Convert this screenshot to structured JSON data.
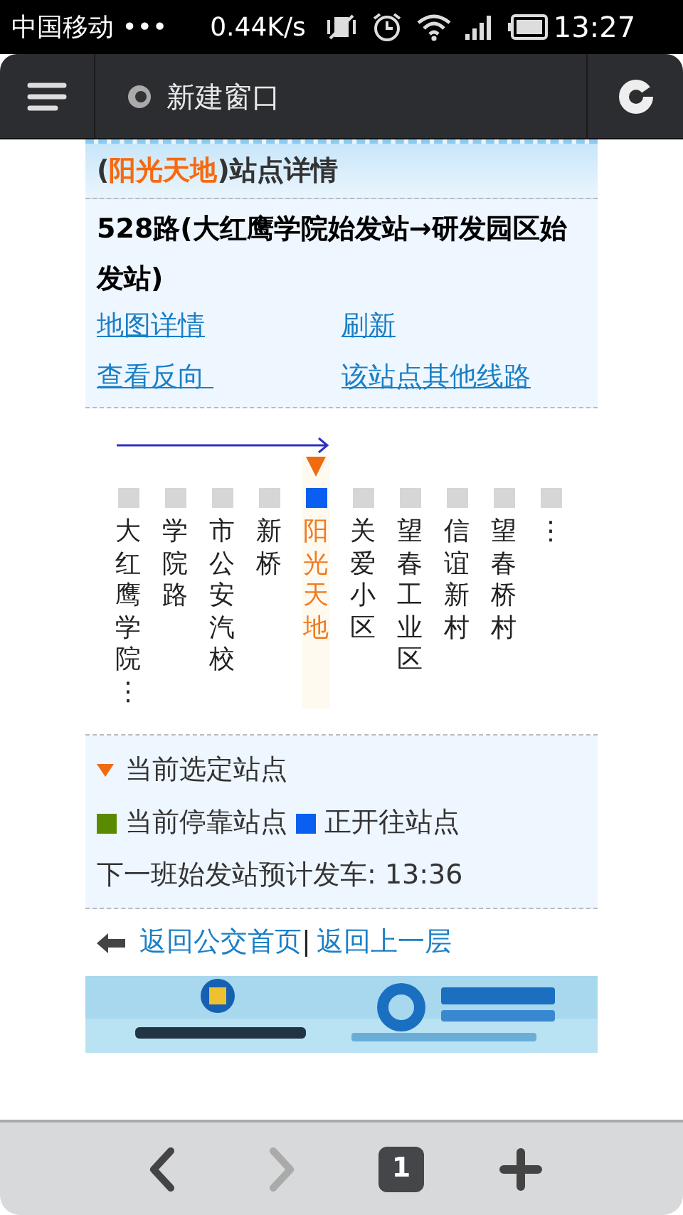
{
  "status_bar": {
    "carrier": "中国移动 •••",
    "speed": "0.44K/s",
    "time": "13:27"
  },
  "toolbar": {
    "title": "新建窗口"
  },
  "header": {
    "open": "(",
    "station": "阳光天地",
    "close": ")站点详情"
  },
  "route": "528路(大红鹰学院始发站→研发园区始发站)",
  "links": [
    "地图详情",
    "刷新",
    "查看反向 ",
    "该站点其他线路"
  ],
  "stations": [
    {
      "name": "大红鹰学院⋮",
      "selected": false,
      "color": "#d6d6d6"
    },
    {
      "name": "学院路",
      "selected": false,
      "color": "#d6d6d6"
    },
    {
      "name": "市公安汽校",
      "selected": false,
      "color": "#d6d6d6"
    },
    {
      "name": "新桥",
      "selected": false,
      "color": "#d6d6d6"
    },
    {
      "name": "阳光天地",
      "selected": true,
      "color": "#0a5ff0"
    },
    {
      "name": "关爱小区",
      "selected": false,
      "color": "#d6d6d6"
    },
    {
      "name": "望春工业区",
      "selected": false,
      "color": "#d6d6d6"
    },
    {
      "name": "信谊新村",
      "selected": false,
      "color": "#d6d6d6"
    },
    {
      "name": "望春桥村",
      "selected": false,
      "color": "#d6d6d6"
    },
    {
      "name": "⋮",
      "selected": false,
      "color": "#d6d6d6"
    }
  ],
  "legend": [
    {
      "kind": "triangle",
      "label": "当前选定站点",
      "color": "#f06a10"
    },
    {
      "kind": "square",
      "label": "当前停靠站点",
      "color": "#5a8a00"
    },
    {
      "kind": "square",
      "label": "正开往站点",
      "color": "#0a5ff0"
    }
  ],
  "next_departure": "下一班始发站预计发车: 13:36",
  "back_links": [
    "返回公交首页",
    "返回上一层"
  ],
  "separator": "|",
  "banner": {
    "kind": "picture"
  },
  "bottom_bar": {
    "tab_count": "1"
  }
}
